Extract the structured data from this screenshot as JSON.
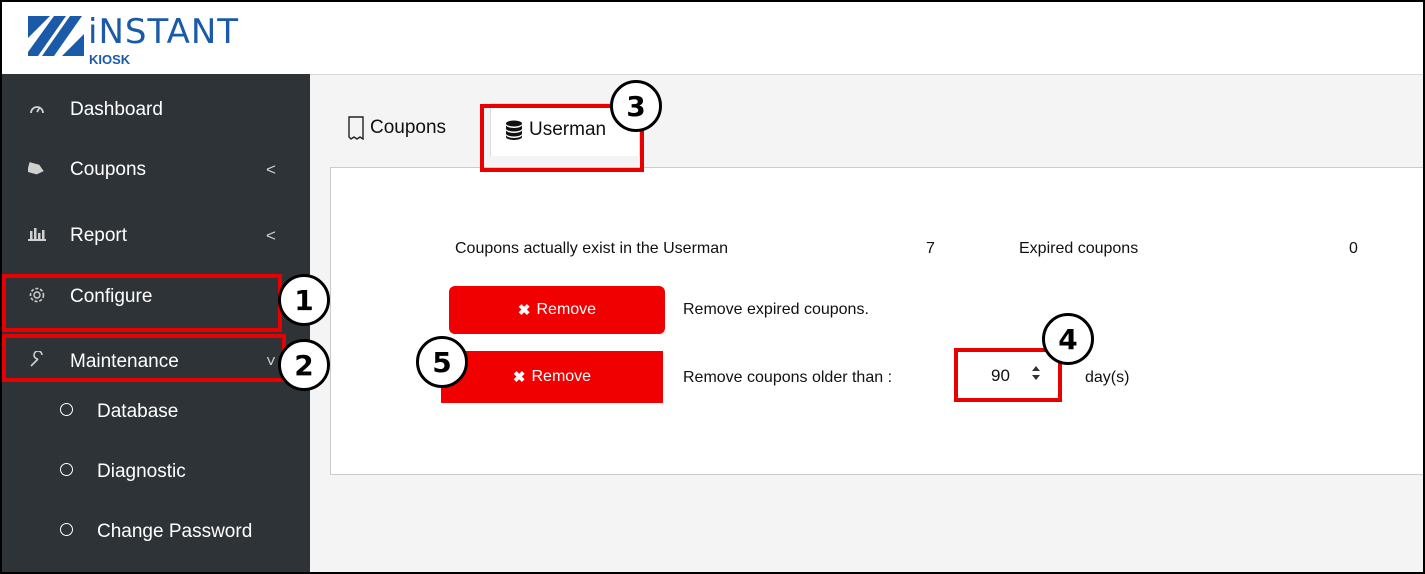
{
  "header": {
    "brand_top": "iNSTANT",
    "brand_bottom": "KIOSK"
  },
  "sidebar": {
    "items": [
      {
        "label": "Dashboard",
        "icon": "gauge-icon"
      },
      {
        "label": "Coupons",
        "icon": "tag-icon",
        "chevron": "<"
      },
      {
        "label": "Report",
        "icon": "bar-chart-icon",
        "chevron": "<"
      },
      {
        "label": "Configure",
        "icon": "gear-icon"
      },
      {
        "label": "Maintenance",
        "icon": "wrench-icon",
        "chevron": "˅"
      }
    ],
    "subitems": [
      {
        "label": "Database"
      },
      {
        "label": "Diagnostic"
      },
      {
        "label": "Change Password"
      }
    ]
  },
  "tabs": [
    {
      "label": "Coupons",
      "icon": "coupon-icon"
    },
    {
      "label": "Userman",
      "icon": "database-icon",
      "active": true
    }
  ],
  "panel": {
    "exist_label": "Coupons actually exist in the Userman",
    "exist_count": "7",
    "expired_label": "Expired coupons",
    "expired_count": "0",
    "remove_button_1": "Remove",
    "remove_text_1": "Remove expired coupons.",
    "remove_button_2": "Remove",
    "remove_text_2": "Remove coupons older than :",
    "days_value": "90",
    "days_unit": "day(s)"
  },
  "annotations": [
    "1",
    "2",
    "3",
    "4",
    "5"
  ],
  "colors": {
    "accent": "#f00000",
    "sidebar": "#2e3337",
    "brand": "#1a5aa8",
    "highlight": "#e80000"
  }
}
